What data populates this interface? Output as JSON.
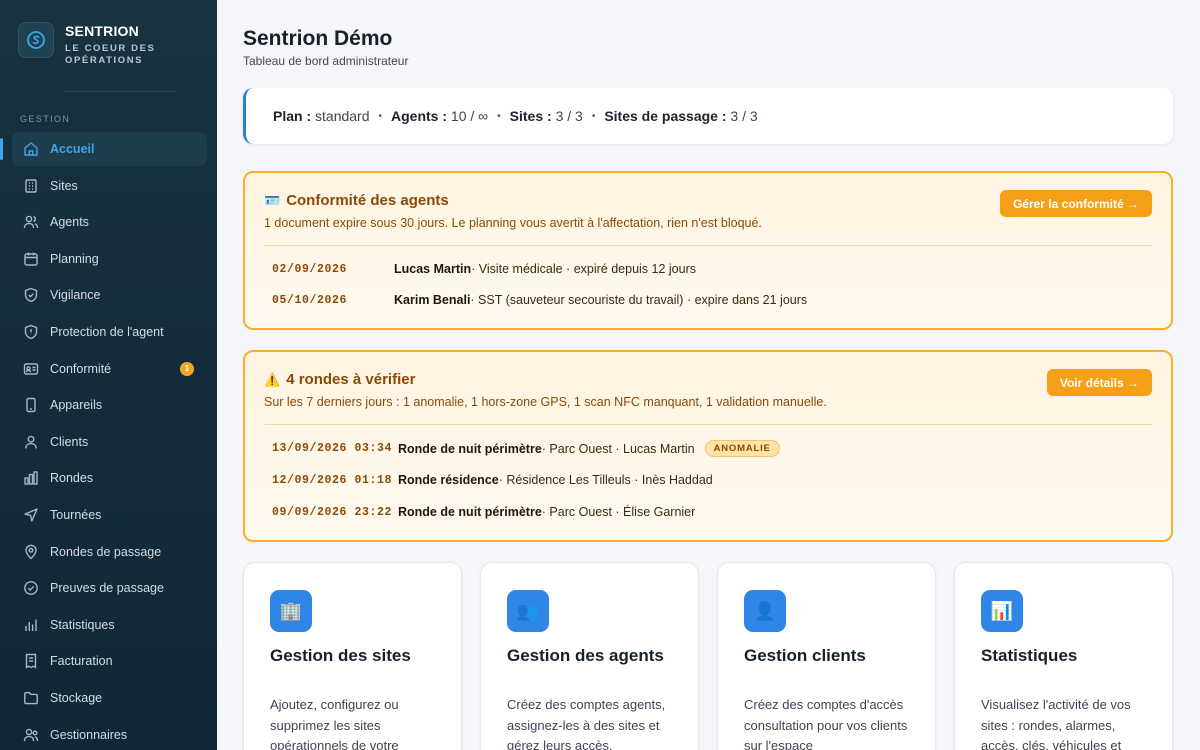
{
  "brand": {
    "name": "SENTRION",
    "subtitle": "LE COEUR DES OPÉRATIONS"
  },
  "sidebar": {
    "section": "GESTION",
    "items": [
      {
        "label": "Accueil",
        "icon": "home-icon"
      },
      {
        "label": "Sites",
        "icon": "building-icon"
      },
      {
        "label": "Agents",
        "icon": "users-icon"
      },
      {
        "label": "Planning",
        "icon": "calendar-icon"
      },
      {
        "label": "Vigilance",
        "icon": "shield-icon"
      },
      {
        "label": "Protection de l'agent",
        "icon": "shield-alert-icon"
      },
      {
        "label": "Conformité",
        "icon": "id-card-icon",
        "badge": "1"
      },
      {
        "label": "Appareils",
        "icon": "smartphone-icon"
      },
      {
        "label": "Clients",
        "icon": "user-icon"
      },
      {
        "label": "Rondes",
        "icon": "bar-chart-icon"
      },
      {
        "label": "Tournées",
        "icon": "navigation-icon"
      },
      {
        "label": "Rondes de passage",
        "icon": "map-pin-icon"
      },
      {
        "label": "Preuves de passage",
        "icon": "check-circle-icon"
      },
      {
        "label": "Statistiques",
        "icon": "stats-icon"
      },
      {
        "label": "Facturation",
        "icon": "receipt-icon"
      },
      {
        "label": "Stockage",
        "icon": "folder-icon"
      },
      {
        "label": "Gestionnaires",
        "icon": "managers-icon"
      }
    ]
  },
  "header": {
    "title": "Sentrion Démo",
    "subtitle": "Tableau de bord administrateur"
  },
  "plan": {
    "plan_label": "Plan :",
    "plan_value": "standard",
    "agents_label": "Agents :",
    "agents_value": "10 / ∞",
    "sites_label": "Sites :",
    "sites_value": "3 / 3",
    "passage_label": "Sites de passage :",
    "passage_value": "3 / 3",
    "separator": "•"
  },
  "compliance": {
    "emoji": "🪪",
    "title": "Conformité des agents",
    "description": "1 document expire sous 30 jours. Le planning vous avertit à l'affectation, rien n'est bloqué.",
    "button": "Gérer la conformité →",
    "rows": [
      {
        "date": "02/09/2026",
        "name": "Lucas Martin",
        "detail": " · Visite médicale · expiré depuis 12 jours"
      },
      {
        "date": "05/10/2026",
        "name": "Karim Benali",
        "detail": " · SST (sauveteur secouriste du travail) · expire dans 21 jours"
      }
    ]
  },
  "rounds": {
    "emoji": "⚠️",
    "title": "4 rondes à vérifier",
    "description": "Sur les 7 derniers jours : 1 anomalie, 1 hors-zone GPS, 1 scan NFC manquant, 1 validation manuelle.",
    "button": "Voir détails →",
    "rows": [
      {
        "date": "13/09/2026 03:34",
        "name": "Ronde de nuit périmètre",
        "detail": " · Parc Ouest · Lucas Martin",
        "tag": "ANOMALIE"
      },
      {
        "date": "12/09/2026 01:18",
        "name": "Ronde résidence",
        "detail": " · Résidence Les Tilleuls · Inès Haddad"
      },
      {
        "date": "09/09/2026 23:22",
        "name": "Ronde de nuit périmètre",
        "detail": " · Parc Ouest · Élise Garnier"
      }
    ]
  },
  "cards": [
    {
      "icon": "🏢",
      "title": "Gestion des sites",
      "description": "Ajoutez, configurez ou supprimez les sites opérationnels de votre"
    },
    {
      "icon": "👥",
      "title": "Gestion des agents",
      "description": "Créez des comptes agents, assignez-les à des sites et gérez leurs accès."
    },
    {
      "icon": "👤",
      "title": "Gestion clients",
      "description": "Créez des comptes d'accès consultation pour vos clients sur l'espace"
    },
    {
      "icon": "📊",
      "title": "Statistiques",
      "description": "Visualisez l'activité de vos sites : rondes, alarmes, accès, clés, véhicules et"
    }
  ],
  "colors": {
    "accent": "#3fa6e6",
    "warning": "#f5a016",
    "sidebar": "#18323f"
  }
}
